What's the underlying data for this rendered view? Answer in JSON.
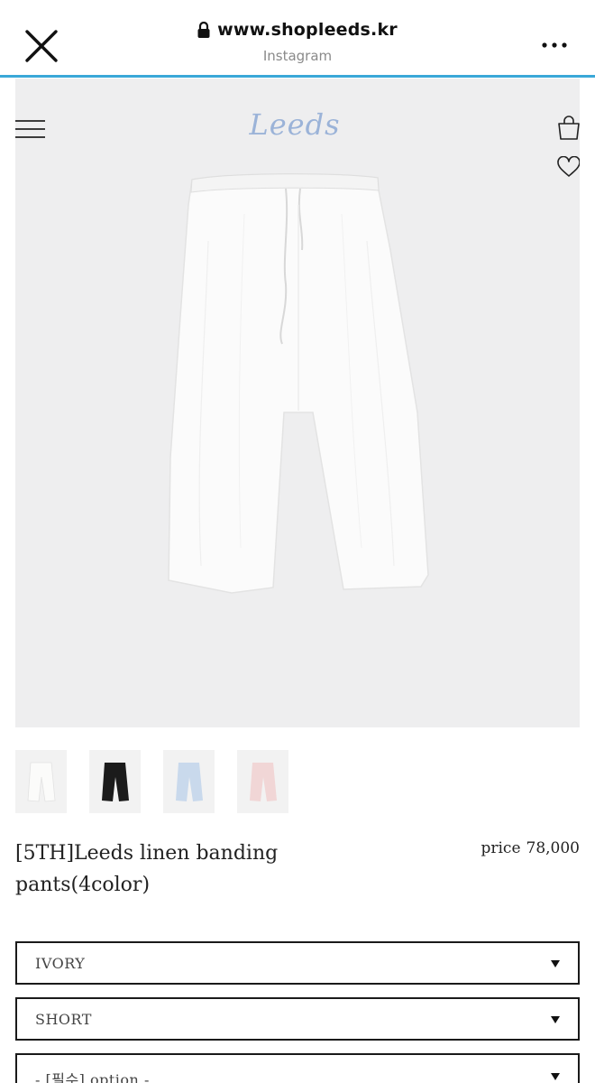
{
  "browser": {
    "url": "www.shopleeds.kr",
    "source": "Instagram",
    "accent_color": "#3aa8d8"
  },
  "header": {
    "logo": "Leeds",
    "icons": [
      "menu-icon",
      "shopping-bag-icon",
      "heart-icon"
    ]
  },
  "hero": {
    "background": "#eeeeef",
    "product_color": "#fafafa"
  },
  "thumbnails": [
    {
      "name": "ivory",
      "color": "#f7f7f5",
      "selected": true
    },
    {
      "name": "black",
      "color": "#1b1b1b",
      "selected": false
    },
    {
      "name": "sky-blue",
      "color": "#c9d9ec",
      "selected": false
    },
    {
      "name": "pink",
      "color": "#f1d6d6",
      "selected": false
    }
  ],
  "product": {
    "name": "[5TH]Leeds linen banding pants(4color)",
    "price_label": "price",
    "price_value": "78,000"
  },
  "options": [
    {
      "value": "IVORY"
    },
    {
      "value": "SHORT"
    },
    {
      "value": "- [필수] option -"
    }
  ]
}
